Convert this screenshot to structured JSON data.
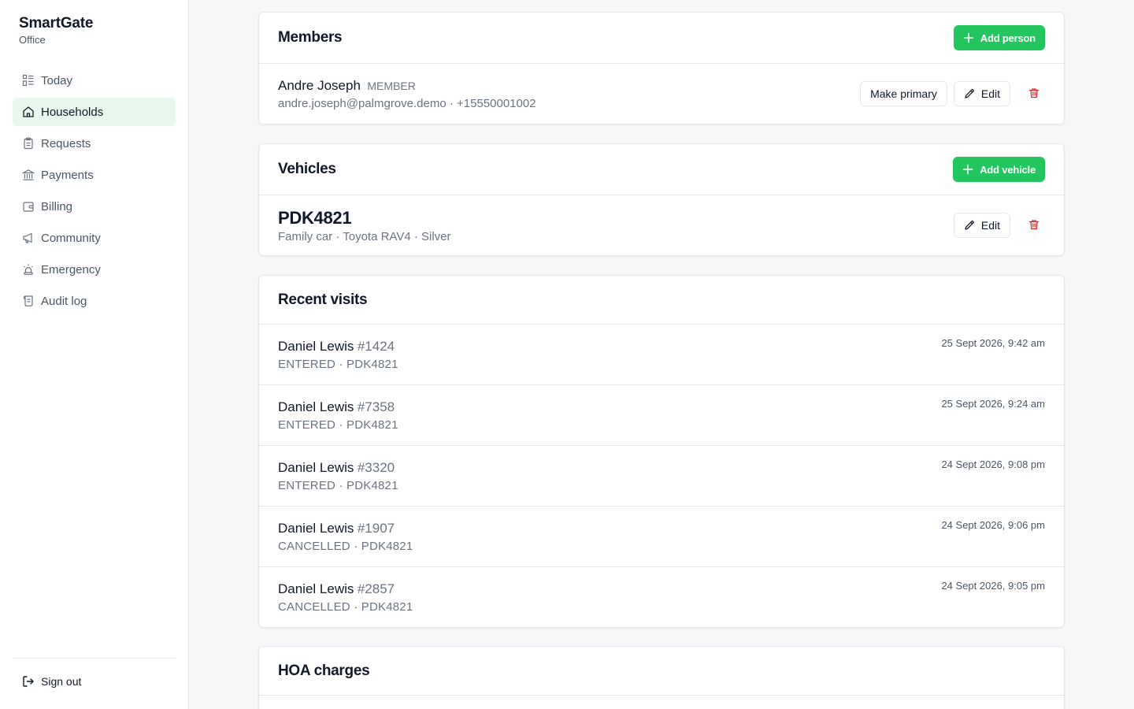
{
  "brand": {
    "name": "SmartGate",
    "subtitle": "Office"
  },
  "nav": {
    "items": [
      {
        "label": "Today",
        "icon": "dashboard-icon"
      },
      {
        "label": "Households",
        "icon": "home-icon",
        "active": true
      },
      {
        "label": "Requests",
        "icon": "clipboard-icon"
      },
      {
        "label": "Payments",
        "icon": "bank-icon"
      },
      {
        "label": "Billing",
        "icon": "wallet-icon"
      },
      {
        "label": "Community",
        "icon": "megaphone-icon"
      },
      {
        "label": "Emergency",
        "icon": "siren-icon"
      },
      {
        "label": "Audit log",
        "icon": "scroll-icon"
      }
    ],
    "signout_label": "Sign out"
  },
  "members": {
    "title": "Members",
    "add_label": "Add person",
    "items": [
      {
        "name": "Andre Joseph",
        "role": "MEMBER",
        "email": "andre.joseph@palmgrove.demo",
        "phone": "+15550001002",
        "primary_label": "Make primary",
        "edit_label": "Edit"
      }
    ]
  },
  "vehicles": {
    "title": "Vehicles",
    "add_label": "Add vehicle",
    "items": [
      {
        "plate": "PDK4821",
        "description": "Family car · Toyota RAV4 · Silver",
        "edit_label": "Edit"
      }
    ]
  },
  "visits": {
    "title": "Recent visits",
    "items": [
      {
        "name": "Daniel Lewis",
        "number": "#1424",
        "status": "ENTERED",
        "plate": "PDK4821",
        "time": "25 Sept 2026, 9:42 am"
      },
      {
        "name": "Daniel Lewis",
        "number": "#7358",
        "status": "ENTERED",
        "plate": "PDK4821",
        "time": "25 Sept 2026, 9:24 am"
      },
      {
        "name": "Daniel Lewis",
        "number": "#3320",
        "status": "ENTERED",
        "plate": "PDK4821",
        "time": "24 Sept 2026, 9:08 pm"
      },
      {
        "name": "Daniel Lewis",
        "number": "#1907",
        "status": "CANCELLED",
        "plate": "PDK4821",
        "time": "24 Sept 2026, 9:06 pm"
      },
      {
        "name": "Daniel Lewis",
        "number": "#2857",
        "status": "CANCELLED",
        "plate": "PDK4821",
        "time": "24 Sept 2026, 9:05 pm"
      }
    ]
  },
  "hoa": {
    "title": "HOA charges"
  },
  "colors": {
    "accent": "#22c55e",
    "active_bg": "#e8f7ee",
    "danger": "#dc2626"
  }
}
